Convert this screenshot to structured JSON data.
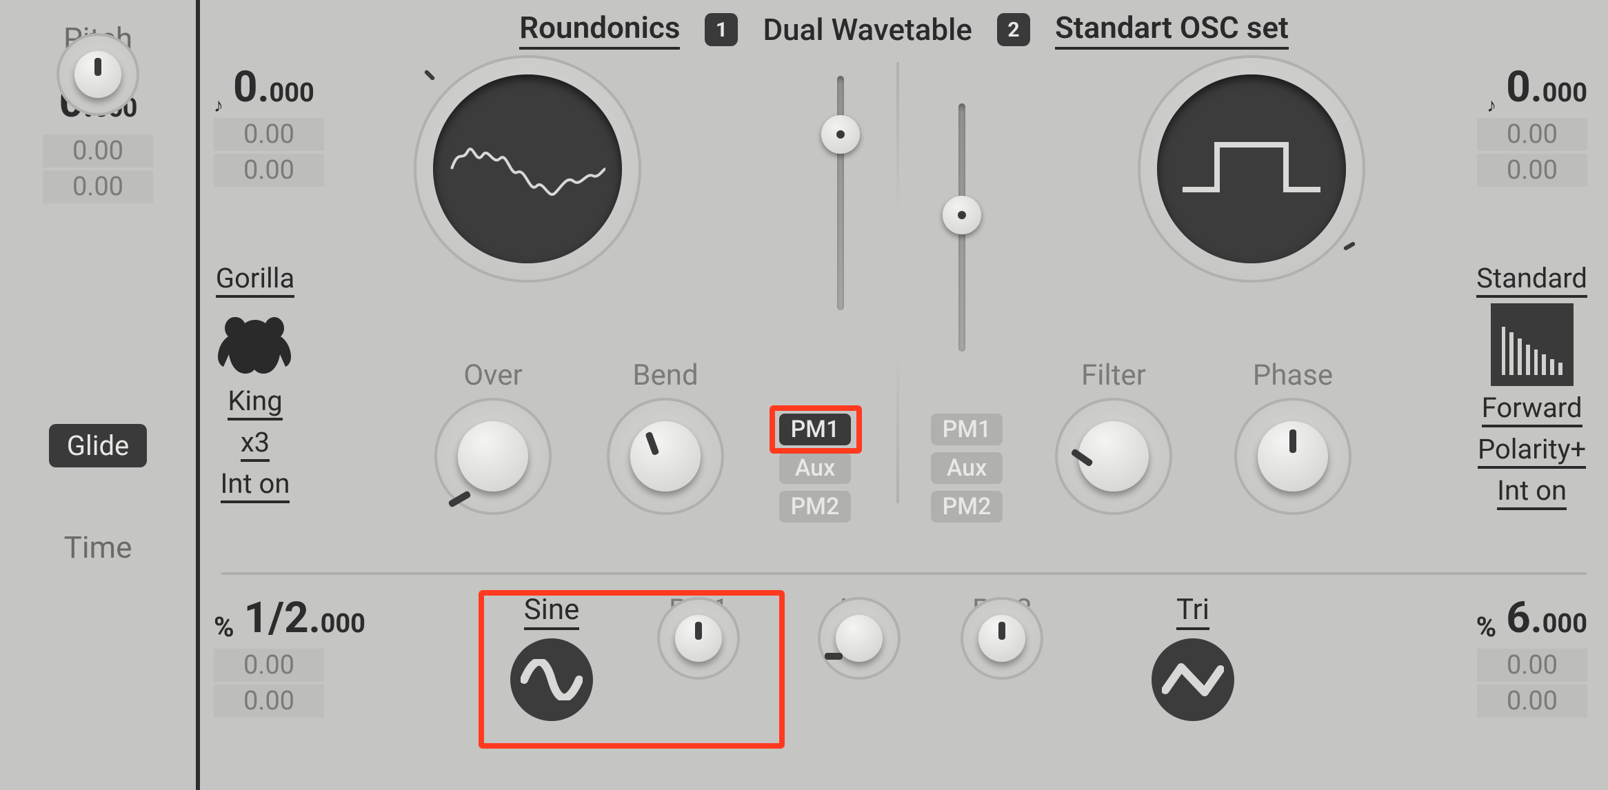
{
  "rail": {
    "pitch_label": "Pitch",
    "pitch_value_int": "0",
    "pitch_value_frac": "000",
    "pitch_mod1": "0.00",
    "pitch_mod2": "0.00",
    "glide_label": "Glide",
    "time_label": "Time"
  },
  "header": {
    "osc1_name": "Roundonics",
    "badge1": "1",
    "center_label": "Dual Wavetable",
    "badge2": "2",
    "osc2_name": "Standart OSC set"
  },
  "osc1": {
    "edge_int": "0",
    "edge_frac": "000",
    "mod1": "0.00",
    "mod2": "0.00",
    "unison_voice": "Gorilla",
    "unison_mode": "King",
    "unison_count": "x3",
    "unison_int": "Int on",
    "over_label": "Over",
    "bend_label": "Bend",
    "tags": {
      "pm1": "PM1",
      "aux": "Aux",
      "pm2": "PM2"
    },
    "ratio_int": "1/2",
    "ratio_frac": "000",
    "ratio_mod1": "0.00",
    "ratio_mod2": "0.00"
  },
  "osc2": {
    "edge_int": "0",
    "edge_frac": "000",
    "mod1": "0.00",
    "mod2": "0.00",
    "mode": "Standard",
    "dir": "Forward",
    "pol": "Polarity+",
    "intl": "Int on",
    "filter_label": "Filter",
    "phase_label": "Phase",
    "tags": {
      "pm1": "PM1",
      "aux": "Aux",
      "pm2": "PM2"
    },
    "ratio_int": "6",
    "ratio_frac": "000",
    "ratio_mod1": "0.00",
    "ratio_mod2": "0.00"
  },
  "bottom": {
    "sine": "Sine",
    "pm1": "PM1",
    "aux": "Aux",
    "pm2": "PM2",
    "tri": "Tri"
  },
  "icons": {
    "note": "♪",
    "pct": "%"
  }
}
